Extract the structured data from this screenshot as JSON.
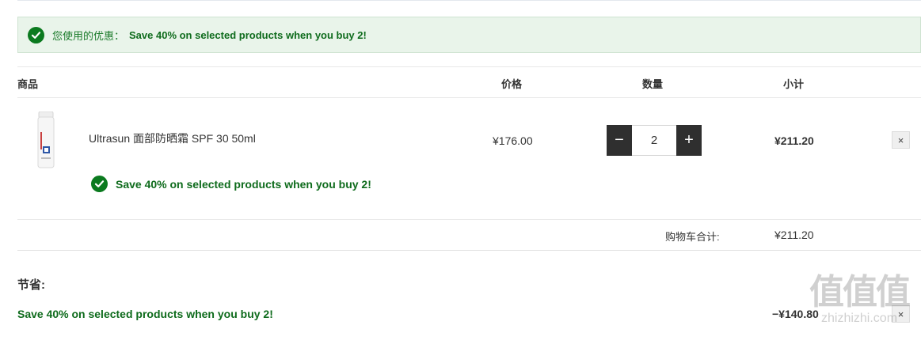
{
  "promo_banner": {
    "prefix": "您使用的优惠：",
    "text": "Save 40% on selected products when you buy 2!"
  },
  "table_header": {
    "product": "商品",
    "price": "价格",
    "quantity": "数量",
    "subtotal": "小计"
  },
  "item": {
    "name": "Ultrasun 面部防晒霜 SPF 30 50ml",
    "price": "¥176.00",
    "quantity": "2",
    "decrement_label": "−",
    "increment_label": "+",
    "subtotal": "¥211.20",
    "remove_label": "×",
    "promo_text": "Save 40% on selected products when you buy 2!"
  },
  "cart_total": {
    "label": "购物车合计:",
    "value": "¥211.20"
  },
  "savings": {
    "title": "节省:",
    "line_label": "Save 40% on selected products when you buy 2!",
    "amount": "−¥140.80",
    "remove_label": "×"
  },
  "watermark": {
    "glyphs": "值值值",
    "text": "zhizhizhi.com"
  },
  "colors": {
    "accent_green": "#0b7a1f",
    "banner_bg": "#e9f4ea",
    "stepper_dark": "#2f2f2f"
  }
}
